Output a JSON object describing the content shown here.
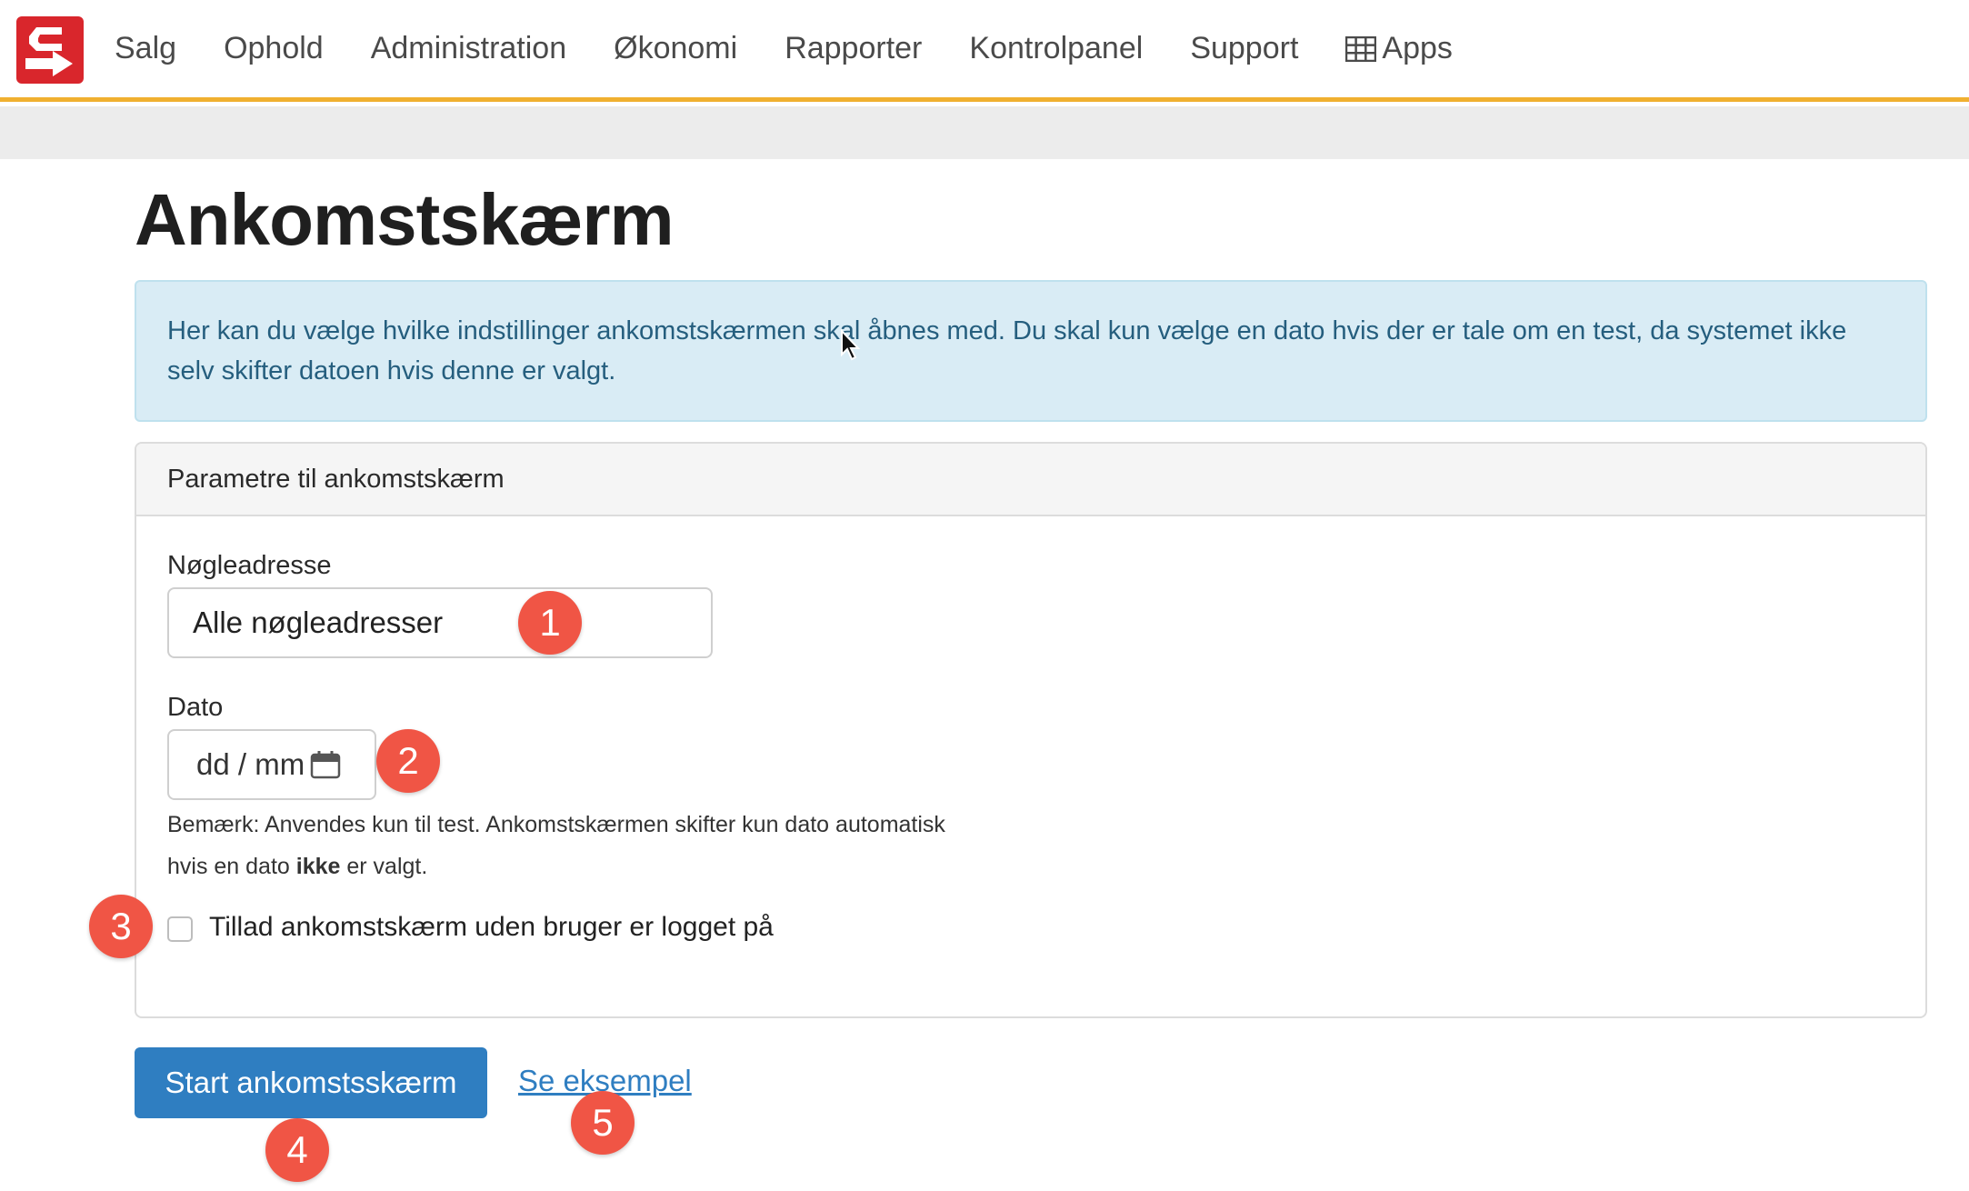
{
  "nav": {
    "items": [
      {
        "label": "Salg"
      },
      {
        "label": "Ophold"
      },
      {
        "label": "Administration"
      },
      {
        "label": "Økonomi"
      },
      {
        "label": "Rapporter"
      },
      {
        "label": "Kontrolpanel"
      },
      {
        "label": "Support"
      },
      {
        "label": "Apps",
        "icon": "grid-icon"
      }
    ]
  },
  "page": {
    "title": "Ankomstskærm",
    "info": "Her kan du vælge hvilke indstillinger ankomstskærmen skal åbnes med. Du skal kun vælge en dato hvis der er tale om en test, da systemet ikke selv skifter datoen hvis denne er valgt."
  },
  "card": {
    "header": "Parametre til ankomstskærm",
    "key_address": {
      "label": "Nøgleadresse",
      "value": "Alle nøgleadresser"
    },
    "date": {
      "label": "Dato",
      "placeholder": "dd / mm",
      "hint_line1": "Bemærk: Anvendes kun til test. Ankomstskærmen skifter kun dato automatisk",
      "hint_line2_pre": "hvis en dato ",
      "hint_line2_bold": "ikke",
      "hint_line2_post": " er valgt."
    },
    "allow_anonymous": {
      "label": "Tillad ankomstskærm uden bruger er logget på",
      "checked": false
    }
  },
  "actions": {
    "start_label": "Start ankomstsskærm",
    "example_label": "Se eksempel"
  },
  "markers": [
    "1",
    "2",
    "3",
    "4",
    "5"
  ],
  "colors": {
    "primary": "#2f7ec1",
    "accent_border": "#f0b030",
    "marker": "#f05545",
    "logo": "#d9262c",
    "info_bg": "#d9ecf5"
  }
}
